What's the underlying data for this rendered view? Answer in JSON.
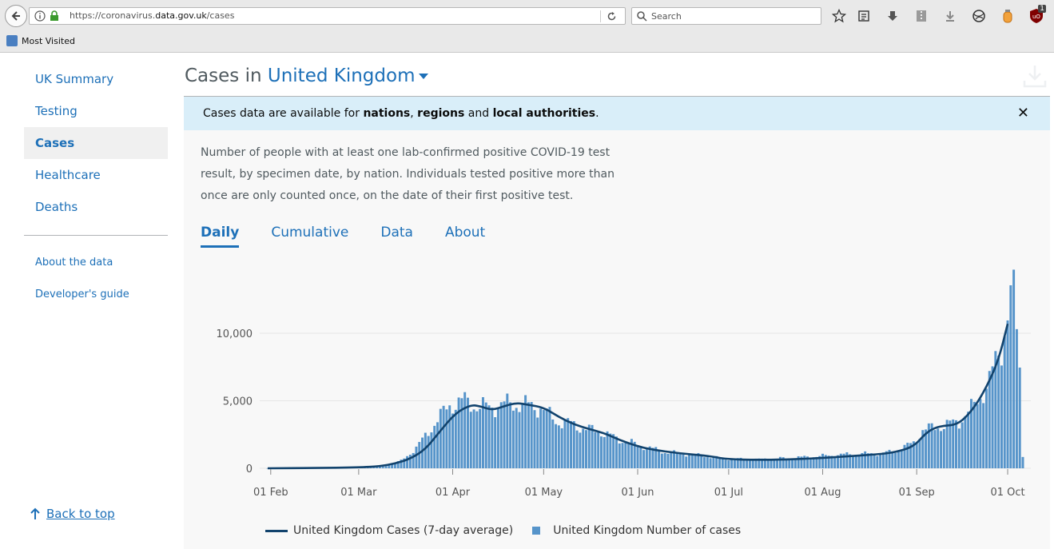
{
  "browser": {
    "url_prefix": "https://coronavirus.",
    "url_domain": "data.gov.uk",
    "url_path": "/cases",
    "search_placeholder": "Search",
    "bookmark": "Most Visited",
    "badge_count": "1"
  },
  "sidebar": {
    "items": [
      {
        "label": "UK Summary"
      },
      {
        "label": "Testing"
      },
      {
        "label": "Cases"
      },
      {
        "label": "Healthcare"
      },
      {
        "label": "Deaths"
      }
    ],
    "secondary": [
      {
        "label": "About the data"
      },
      {
        "label": "Developer's guide"
      }
    ],
    "back_to_top": "Back to top"
  },
  "header": {
    "prefix": "Cases in",
    "area": "United Kingdom"
  },
  "banner": {
    "text_start": "Cases data are available for ",
    "nations": "nations",
    "comma": ", ",
    "regions": "regions",
    "and": " and ",
    "local": "local authorities",
    "period": "."
  },
  "description": "Number of people with at least one lab-confirmed positive COVID-19 test result, by specimen date, by nation. Individuals tested positive more than once are only counted once, on the date of their first positive test.",
  "tabs": [
    {
      "label": "Daily"
    },
    {
      "label": "Cumulative"
    },
    {
      "label": "Data"
    },
    {
      "label": "About"
    }
  ],
  "colors": {
    "bar": "#5694ca",
    "line": "#12436d",
    "link": "#1d70b8"
  },
  "chart_data": {
    "type": "bar",
    "x_start": "2020-01-31",
    "x_end": "2020-10-06",
    "x_tick_labels": [
      "01 Feb",
      "01 Mar",
      "01 Apr",
      "01 May",
      "01 Jun",
      "01 Jul",
      "01 Aug",
      "01 Sep",
      "01 Oct"
    ],
    "y_tick_labels": [
      "0",
      "5,000",
      "10,000"
    ],
    "ylim": [
      0,
      13500
    ],
    "grid": true,
    "legend_position": "bottom",
    "series": [
      {
        "name": "United Kingdom Number of cases",
        "type": "bar",
        "keypoints": [
          [
            "2020-01-31",
            2
          ],
          [
            "2020-02-15",
            5
          ],
          [
            "2020-03-01",
            40
          ],
          [
            "2020-03-10",
            200
          ],
          [
            "2020-03-15",
            550
          ],
          [
            "2020-03-20",
            1500
          ],
          [
            "2020-03-25",
            3000
          ],
          [
            "2020-03-31",
            4700
          ],
          [
            "2020-04-05",
            5000
          ],
          [
            "2020-04-10",
            4500
          ],
          [
            "2020-04-15",
            4600
          ],
          [
            "2020-04-20",
            4800
          ],
          [
            "2020-04-25",
            4700
          ],
          [
            "2020-04-30",
            4500
          ],
          [
            "2020-05-05",
            3500
          ],
          [
            "2020-05-10",
            3300
          ],
          [
            "2020-05-15",
            2900
          ],
          [
            "2020-05-20",
            2700
          ],
          [
            "2020-05-25",
            2200
          ],
          [
            "2020-05-31",
            1800
          ],
          [
            "2020-06-05",
            1500
          ],
          [
            "2020-06-10",
            1200
          ],
          [
            "2020-06-20",
            1000
          ],
          [
            "2020-06-30",
            700
          ],
          [
            "2020-07-10",
            650
          ],
          [
            "2020-07-20",
            750
          ],
          [
            "2020-07-31",
            900
          ],
          [
            "2020-08-10",
            1050
          ],
          [
            "2020-08-20",
            1100
          ],
          [
            "2020-08-25",
            1250
          ],
          [
            "2020-08-31",
            1900
          ],
          [
            "2020-09-03",
            2800
          ],
          [
            "2020-09-08",
            3100
          ],
          [
            "2020-09-11",
            3200
          ],
          [
            "2020-09-15",
            3500
          ],
          [
            "2020-09-20",
            4600
          ],
          [
            "2020-09-25",
            6500
          ],
          [
            "2020-09-29",
            9000
          ],
          [
            "2020-10-02",
            13000
          ],
          [
            "2020-10-03",
            12500
          ],
          [
            "2020-10-04",
            10000
          ],
          [
            "2020-10-05",
            7500
          ],
          [
            "2020-10-06",
            900
          ]
        ]
      },
      {
        "name": "United Kingdom Cases (7-day average)",
        "type": "line",
        "points": [
          [
            "2020-01-31",
            0
          ],
          [
            "2020-02-15",
            20
          ],
          [
            "2020-03-01",
            60
          ],
          [
            "2020-03-08",
            150
          ],
          [
            "2020-03-13",
            350
          ],
          [
            "2020-03-18",
            700
          ],
          [
            "2020-03-23",
            1400
          ],
          [
            "2020-03-28",
            2800
          ],
          [
            "2020-04-02",
            4100
          ],
          [
            "2020-04-07",
            4700
          ],
          [
            "2020-04-10",
            4600
          ],
          [
            "2020-04-14",
            4300
          ],
          [
            "2020-04-18",
            4600
          ],
          [
            "2020-04-22",
            4850
          ],
          [
            "2020-04-26",
            4700
          ],
          [
            "2020-05-01",
            4500
          ],
          [
            "2020-05-06",
            3800
          ],
          [
            "2020-05-11",
            3250
          ],
          [
            "2020-05-16",
            2900
          ],
          [
            "2020-05-21",
            2600
          ],
          [
            "2020-05-26",
            2100
          ],
          [
            "2020-05-31",
            1700
          ],
          [
            "2020-06-05",
            1400
          ],
          [
            "2020-06-15",
            1100
          ],
          [
            "2020-06-25",
            900
          ],
          [
            "2020-06-30",
            680
          ],
          [
            "2020-07-10",
            620
          ],
          [
            "2020-07-20",
            650
          ],
          [
            "2020-07-31",
            750
          ],
          [
            "2020-08-10",
            900
          ],
          [
            "2020-08-20",
            1050
          ],
          [
            "2020-08-25",
            1200
          ],
          [
            "2020-08-31",
            1600
          ],
          [
            "2020-09-04",
            2600
          ],
          [
            "2020-09-07",
            3000
          ],
          [
            "2020-09-10",
            3150
          ],
          [
            "2020-09-13",
            3200
          ],
          [
            "2020-09-16",
            3500
          ],
          [
            "2020-09-20",
            4500
          ],
          [
            "2020-09-24",
            6000
          ],
          [
            "2020-09-28",
            8000
          ],
          [
            "2020-10-01",
            10700
          ]
        ]
      }
    ]
  }
}
